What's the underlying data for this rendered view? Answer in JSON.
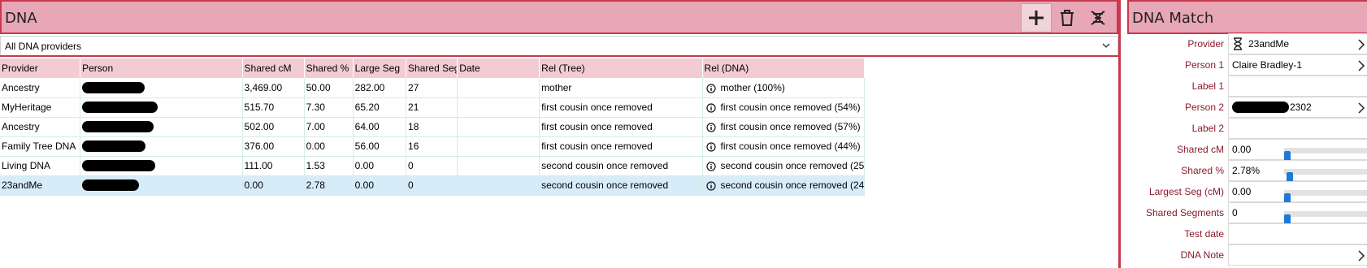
{
  "left_panel": {
    "title": "DNA",
    "toolbar": {
      "add_icon": "plus-icon",
      "delete_icon": "trash-icon",
      "tree_icon": "dna-tree-icon"
    },
    "filter": {
      "selected": "All DNA providers"
    },
    "table": {
      "columns": [
        "Provider",
        "Person",
        "Shared cM",
        "Shared %",
        "Large Seg",
        "Shared Seg",
        "Date",
        "Rel (Tree)",
        "Rel (DNA)"
      ],
      "rows": [
        {
          "provider": "Ancestry",
          "shared_cm": "3,469.00",
          "shared_pct": "50.00",
          "large_seg": "282.00",
          "shared_seg": "27",
          "date": "",
          "rel_tree": "mother",
          "rel_dna": "mother (100%)"
        },
        {
          "provider": "MyHeritage",
          "shared_cm": "515.70",
          "shared_pct": "7.30",
          "large_seg": "65.20",
          "shared_seg": "21",
          "date": "",
          "rel_tree": "first cousin once removed",
          "rel_dna": "first cousin once removed (54%)"
        },
        {
          "provider": "Ancestry",
          "shared_cm": "502.00",
          "shared_pct": "7.00",
          "large_seg": "64.00",
          "shared_seg": "18",
          "date": "",
          "rel_tree": "first cousin once removed",
          "rel_dna": "first cousin once removed (57%)"
        },
        {
          "provider": "Family Tree DNA",
          "shared_cm": "376.00",
          "shared_pct": "0.00",
          "large_seg": "56.00",
          "shared_seg": "16",
          "date": "",
          "rel_tree": "first cousin once removed",
          "rel_dna": "first cousin once removed (44%)"
        },
        {
          "provider": "Living DNA",
          "shared_cm": "111.00",
          "shared_pct": "1.53",
          "large_seg": "0.00",
          "shared_seg": "0",
          "date": "",
          "rel_tree": "second cousin once removed",
          "rel_dna": "second cousin once removed (25"
        },
        {
          "provider": "23andMe",
          "shared_cm": "0.00",
          "shared_pct": "2.78",
          "large_seg": "0.00",
          "shared_seg": "0",
          "date": "",
          "rel_tree": "second cousin once removed",
          "rel_dna": "second cousin once removed (24"
        }
      ]
    }
  },
  "right_panel": {
    "title": "DNA Match",
    "provider": {
      "label": "Provider",
      "value": "23andMe",
      "icon": "hourglass-icon"
    },
    "person1": {
      "label": "Person 1",
      "value": "Claire Bradley-1"
    },
    "label1": {
      "label": "Label 1",
      "value": ""
    },
    "person2": {
      "label": "Person 2",
      "value_suffix": "2302"
    },
    "label2": {
      "label": "Label 2",
      "value": ""
    },
    "shared_cm": {
      "label": "Shared cM",
      "value": "0.00",
      "slider": 0.0
    },
    "shared_pct": {
      "label": "Shared %",
      "value": "2.78%",
      "slider": 0.0278
    },
    "largest_seg": {
      "label": "Largest Seg (cM)",
      "value": "0.00",
      "slider": 0.0
    },
    "shared_segments": {
      "label": "Shared Segments",
      "value": "0",
      "slider": 0.0
    },
    "test_date": {
      "label": "Test date",
      "value": ""
    },
    "dna_note": {
      "label": "DNA Note",
      "value": ""
    }
  },
  "colors": {
    "header_bg": "#e8a7b6",
    "header_border": "#c9384c",
    "table_header_bg": "#f2cbd3",
    "selected_row_bg": "#d7ecf9",
    "label_text": "#8b1a2b",
    "slider_thumb": "#1e7ad6"
  }
}
